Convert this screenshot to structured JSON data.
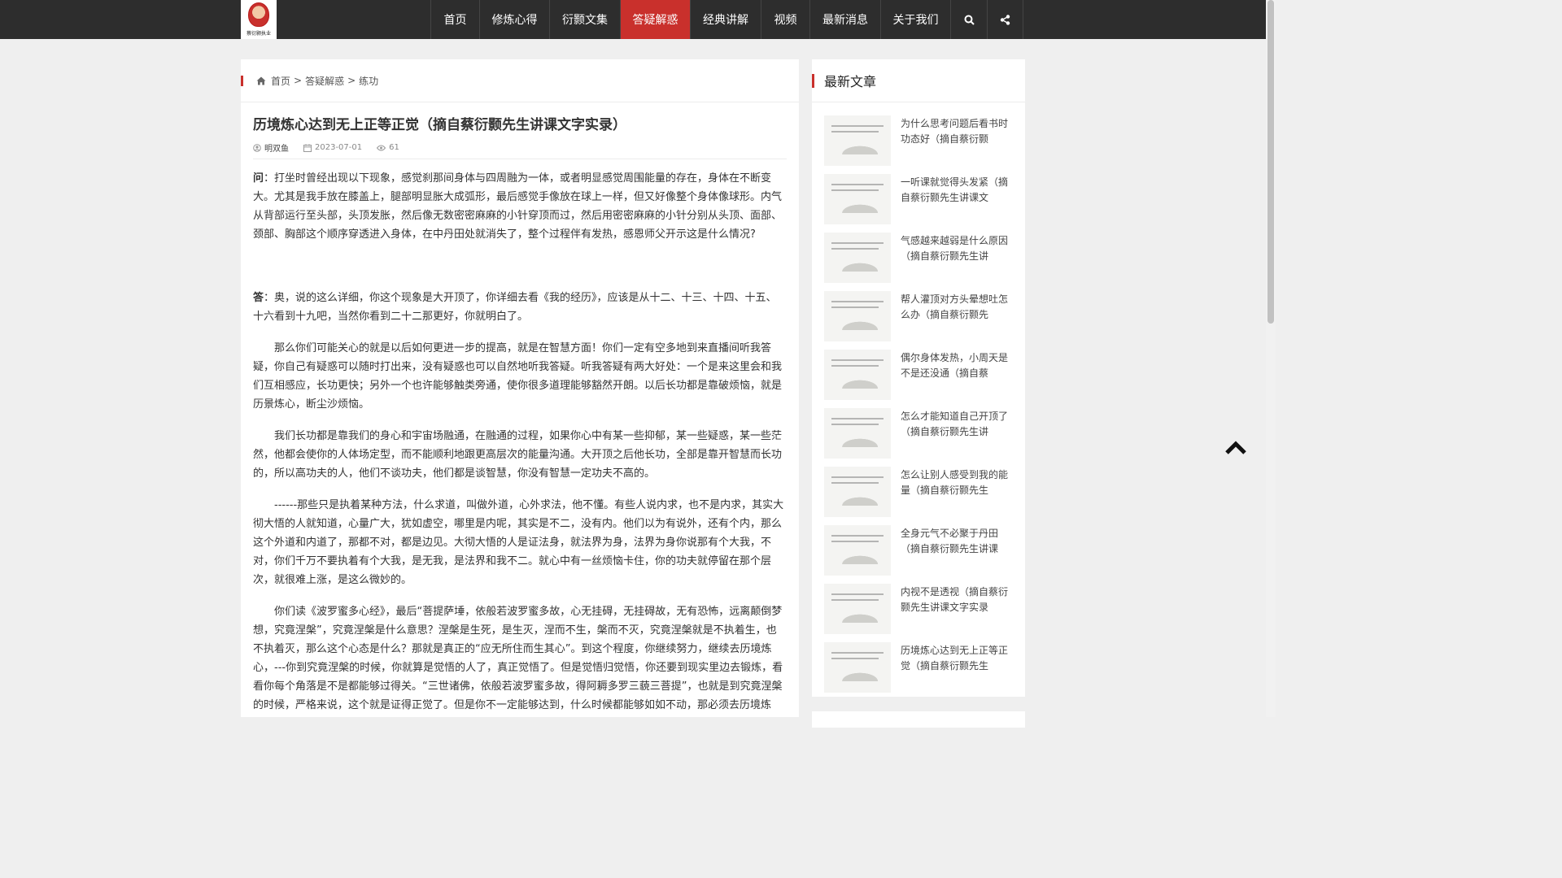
{
  "logo": {
    "alt_text": "蔡衍颢执业"
  },
  "nav": [
    {
      "label": "首页",
      "active": false
    },
    {
      "label": "修炼心得",
      "active": false
    },
    {
      "label": "衍颢文集",
      "active": false
    },
    {
      "label": "答疑解惑",
      "active": true
    },
    {
      "label": "经典讲解",
      "active": false
    },
    {
      "label": "视频",
      "active": false
    },
    {
      "label": "最新消息",
      "active": false
    },
    {
      "label": "关于我们",
      "active": false
    }
  ],
  "nav_icons": [
    "search-icon",
    "share-icon"
  ],
  "breadcrumb": {
    "home": "首页",
    "sep": ">",
    "category": "答疑解惑",
    "current": "练功"
  },
  "article": {
    "title": "历境炼心达到无上正等正觉（摘自蔡衍颢先生讲课文字实录）",
    "author": "明双鱼",
    "date": "2023-07-01",
    "views": "61",
    "q_label": "问",
    "q_text": "：打坐时曾经出现以下现象，感觉刹那间身体与四周融为一体，或者明显感觉周围能量的存在，身体在不断变大。尤其是我手放在膝盖上，腿部明显胀大成弧形，最后感觉手像放在球上一样，但又好像整个身体像球形。内气从背部运行至头部，头顶发胀，然后像无数密密麻麻的小针穿顶而过，然后用密密麻麻的小针分别从头顶、面部、颈部、胸部这个顺序穿透进入身体，在中丹田处就消失了，整个过程伴有发热，感恩师父开示这是什么情况?",
    "a_label": "答",
    "a_text": "：奥，说的这么详细，你这个现象是大开顶了，你详细去看《我的经历》，应该是从十二、十三、十四、十五、十六看到十九吧，当然你看到二十二那更好，你就明白了。",
    "p1": "那么你们可能关心的就是以后如何更进一步的提高，就是在智慧方面！你们一定有空多地到来直播间听我答疑，你自己有疑惑可以随时打出来，没有疑惑也可以自然地听我答疑。听我答疑有两大好处：一个是来这里会和我们互相感应，长功更快；另外一个也许能够触类旁通，使你很多道理能够豁然开朗。以后长功都是靠破烦恼，就是历景炼心，断尘沙烦恼。",
    "p2": "我们长功都是靠我们的身心和宇宙场融通，在融通的过程，如果你心中有某一些抑郁，某一些疑惑，某一些茫然，他都会使你的人体场定型，而不能顺利地跟更高层次的能量沟通。大开顶之后他长功，全部是靠开智慧而长功的，所以高功夫的人，他们不谈功夫，他们都是谈智慧，你没有智慧一定功夫不高的。",
    "p3": "------那些只是执着某种方法，什么求道，叫做外道，心外求法，他不懂。有些人说内求，也不是内求，其实大彻大悟的人就知道，心量广大，犹如虚空，哪里是内呢，其实是不二，没有内。他们以为有说外，还有个内，那么这个外道和内道了，那都不对，都是边见。大彻大悟的人是证法身，就法界为身，法界为身你说那有个大我，不对，你们千万不要执着有个大我，是无我，是法界和我不二。就心中有一丝烦恼卡住，你的功夫就停留在那个层次，就很难上涨，是这么微妙的。",
    "p4": "你们读《波罗蜜多心经》，最后“菩提萨埵，依般若波罗蜜多故，心无挂碍，无挂碍故，无有恐怖，远离颠倒梦想，究竟涅槃”，究竟涅槃是什么意思？涅槃是生死，是生灭，涅而不生，槃而不灭，究竟涅槃就是不执着生，也不执着灭，那么这个心态是什么？那就是真正的“应无所住而生其心”。到这个程度，你继续努力，继续去历境炼心，---你到究竟涅槃的时候，你就算是觉悟的人了，真正觉悟了。但是觉悟归觉悟，你还要到现实里边去锻炼，看看你每个角落是不是都能够过得关。“三世诸佛，依般若波罗蜜多故，得阿耨多罗三藐三菩提”，也就是到究竟涅槃的时候，严格来说，这个就是证得正觉了。但是你不一定能够达到，什么时候都能够如如不动，那必须去历境炼"
  },
  "sidebar": {
    "title": "最新文章",
    "posts": [
      {
        "title": "为什么思考问题后看书时功态好（摘自蔡衍颢"
      },
      {
        "title": "一听课就觉得头发紧（摘自蔡衍颢先生讲课文"
      },
      {
        "title": "气感越来越弱是什么原因（摘自蔡衍颢先生讲"
      },
      {
        "title": "帮人灌顶对方头晕想吐怎么办（摘自蔡衍颢先"
      },
      {
        "title": "偶尔身体发热，小周天是不是还没通（摘自蔡"
      },
      {
        "title": "怎么才能知道自己开顶了（摘自蔡衍颢先生讲"
      },
      {
        "title": "怎么让别人感受到我的能量（摘自蔡衍颢先生"
      },
      {
        "title": "全身元气不必聚于丹田（摘自蔡衍颢先生讲课"
      },
      {
        "title": "内视不是透视（摘自蔡衍颢先生讲课文字实录"
      },
      {
        "title": "历境炼心达到无上正等正觉（摘自蔡衍颢先生"
      }
    ]
  },
  "colors": {
    "nav_bg": "#2d2d2d",
    "accent": "#c9302c",
    "page_bg": "#efefef"
  }
}
